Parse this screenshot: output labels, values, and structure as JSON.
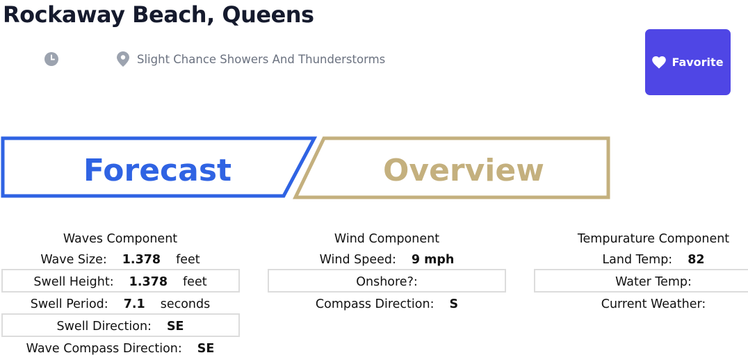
{
  "location": {
    "title": "Rockaway Beach, Queens"
  },
  "header": {
    "time_text": "",
    "weather_summary": "Slight Chance Showers And Thunderstorms",
    "favorite_label": "Favorite"
  },
  "tabs": [
    {
      "label": "Forecast",
      "active": true,
      "color": "#2f63e3"
    },
    {
      "label": "Overview",
      "active": false,
      "color": "#c4b07e"
    }
  ],
  "waves": {
    "heading": "Waves Component",
    "wave_size_label": "Wave Size:",
    "wave_size_value": "1.378",
    "wave_size_unit": "feet",
    "swell_height_label": "Swell Height:",
    "swell_height_value": "1.378",
    "swell_height_unit": "feet",
    "swell_period_label": "Swell Period:",
    "swell_period_value": "7.1",
    "swell_period_unit": "seconds",
    "swell_direction_label": "Swell Direction:",
    "swell_direction_value": "SE",
    "wave_compass_label": "Wave Compass Direction:",
    "wave_compass_value": "SE"
  },
  "wind": {
    "heading": "Wind Component",
    "speed_label": "Wind Speed:",
    "speed_value": "9 mph",
    "onshore_label": "Onshore?:",
    "onshore_value": "",
    "compass_label": "Compass Direction:",
    "compass_value": "S"
  },
  "temperature": {
    "heading": "Tempurature Component",
    "land_label": "Land Temp:",
    "land_value": "82",
    "water_label": "Water Temp:",
    "water_value": "",
    "weather_label": "Current Weather:",
    "weather_value": ""
  },
  "colors": {
    "accent": "#4f46e5",
    "forecast_blue": "#2f63e3",
    "overview_gold": "#c4b07e",
    "title_dark": "#151a2d",
    "muted": "#6b7280"
  },
  "icons": {
    "time": "clock-icon",
    "location": "map-pin-icon",
    "favorite": "heart-icon"
  }
}
